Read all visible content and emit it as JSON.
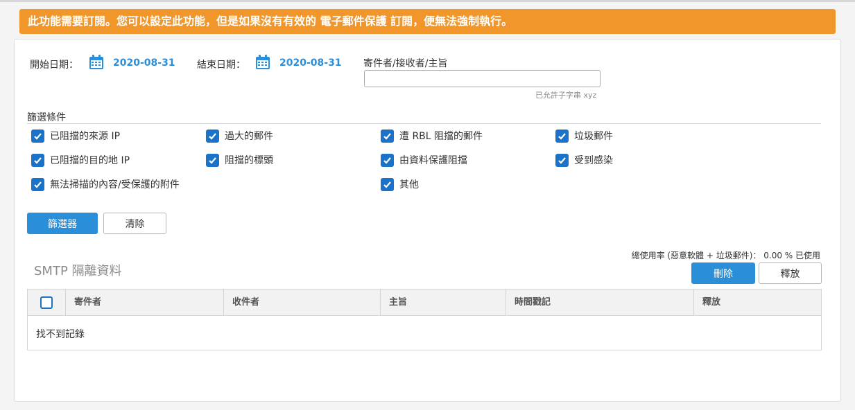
{
  "banner": {
    "text": "此功能需要訂閱。您可以設定此功能，但是如果沒有有效的 電子郵件保護 訂閱，便無法強制執行。"
  },
  "dates": {
    "start_label": "開始日期：",
    "start_value": "2020-08-31",
    "end_label": "結束日期：",
    "end_value": "2020-08-31",
    "icon": "calendar-icon"
  },
  "search": {
    "label": "寄件者/接收者/主旨",
    "value": "",
    "placeholder": "",
    "hint": "已允許子字串 xyz"
  },
  "filters": {
    "title": "篩選條件",
    "items": [
      {
        "label": "已阻擋的來源 IP",
        "checked": true
      },
      {
        "label": "過大的郵件",
        "checked": true
      },
      {
        "label": "遭 RBL 阻擋的郵件",
        "checked": true
      },
      {
        "label": "垃圾郵件",
        "checked": true
      },
      {
        "label": "已阻擋的目的地 IP",
        "checked": true
      },
      {
        "label": "阻擋的標頭",
        "checked": true
      },
      {
        "label": "由資料保護阻擋",
        "checked": true
      },
      {
        "label": "受到感染",
        "checked": true
      },
      {
        "label": "無法掃描的內容/受保護的附件",
        "checked": true
      },
      {
        "label": "其他",
        "checked": true
      }
    ]
  },
  "actions": {
    "filter_label": "篩選器",
    "clear_label": "清除"
  },
  "quarantine": {
    "usage": "總使用率 (惡意軟體 + 垃圾郵件)： 0.00 % 已使用",
    "title": "SMTP 隔離資料",
    "delete_label": "刪除",
    "release_label": "釋放",
    "columns": [
      "寄件者",
      "收件者",
      "主旨",
      "時間戳記",
      "釋放"
    ],
    "empty_text": "找不到記錄"
  },
  "colors": {
    "banner": "#f0962a",
    "accent": "#2a8fd8",
    "checkbox": "#1a73c8",
    "date": "#2a8fd8"
  }
}
